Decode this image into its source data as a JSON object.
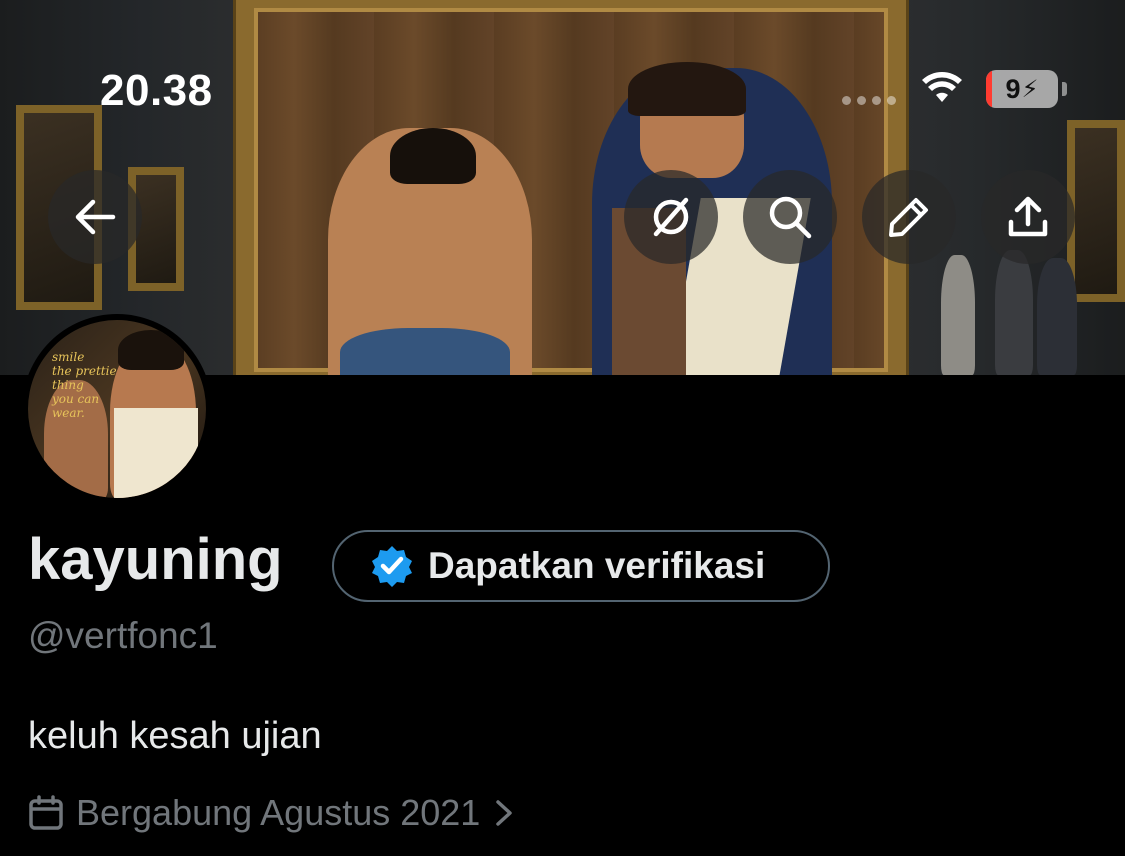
{
  "status_bar": {
    "time": "20.38",
    "battery_level": "9",
    "charging": true,
    "wifi_icon": "wifi-icon"
  },
  "header": {
    "back_icon": "arrow-left-icon",
    "actions": [
      {
        "name": "no-notifications",
        "icon": "slashed-circle-icon"
      },
      {
        "name": "search",
        "icon": "search-icon"
      },
      {
        "name": "edit",
        "icon": "pencil-icon"
      },
      {
        "name": "share",
        "icon": "share-upload-icon"
      }
    ]
  },
  "profile": {
    "display_name": "kayuning",
    "verify_label": "Dapatkan verifikasi",
    "handle": "@vertfonc1",
    "bio": "keluh kesah ujian",
    "joined": "Bergabung Agustus 2021",
    "avatar_scrawl": [
      "smile",
      "the prettie",
      "thing",
      "you can",
      "wear."
    ]
  },
  "colors": {
    "background": "#000000",
    "text_primary": "#e7e9ea",
    "text_secondary": "#71767b",
    "verified_blue": "#1d9bf0",
    "border": "#536471",
    "battery_low": "#ff3b30"
  }
}
